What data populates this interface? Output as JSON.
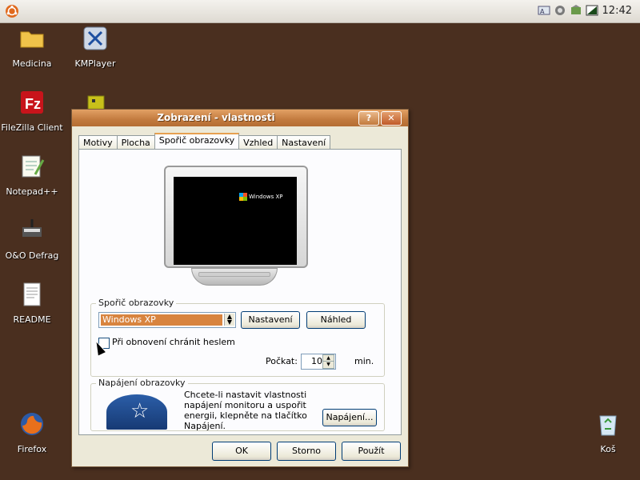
{
  "topbar": {
    "clock": "12:42",
    "tray_icons": [
      "keyboard-layout-icon",
      "network-icon",
      "update-icon",
      "battery-icon"
    ]
  },
  "desktop": {
    "icons": [
      {
        "label": "Medicina",
        "icon": "folder-icon"
      },
      {
        "label": "KMPlayer",
        "icon": "kmplayer-icon"
      },
      {
        "label": "FileZilla Client",
        "icon": "filezilla-icon"
      },
      {
        "label": "Notepad++",
        "icon": "notepad-icon"
      },
      {
        "label": "O&O Defrag",
        "icon": "defrag-icon"
      },
      {
        "label": "README",
        "icon": "document-icon"
      },
      {
        "label": "Firefox",
        "icon": "firefox-icon"
      },
      {
        "label": "Koš",
        "icon": "recycle-bin-icon"
      }
    ]
  },
  "dialog": {
    "title": "Zobrazení - vlastnosti",
    "help_label": "?",
    "close_label": "✕",
    "tabs": [
      {
        "label": "Motivy"
      },
      {
        "label": "Plocha"
      },
      {
        "label": "Spořič obrazovky",
        "active": true
      },
      {
        "label": "Vzhled"
      },
      {
        "label": "Nastavení"
      }
    ],
    "preview": {
      "brand": "Windows XP"
    },
    "screensaver": {
      "group_title": "Spořič obrazovky",
      "selected": "Windows XP",
      "settings_button": "Nastavení",
      "preview_button": "Náhled",
      "password_checkbox_label": "Při obnovení chránit heslem",
      "password_checked": false,
      "wait_label": "Počkat:",
      "wait_value": "10",
      "wait_unit": "min."
    },
    "power": {
      "group_title": "Napájení obrazovky",
      "description": "Chcete-li nastavit vlastnosti napájení monitoru a uspořit energii, klepněte na tlačítko Napájení.",
      "button": "Napájení..."
    },
    "buttons": {
      "ok": "OK",
      "cancel": "Storno",
      "apply": "Použít"
    }
  }
}
